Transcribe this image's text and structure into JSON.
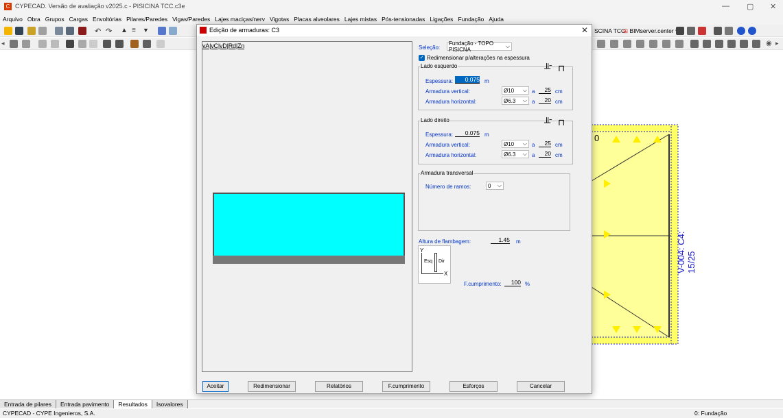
{
  "window": {
    "title": "CYPECAD. Versão de avaliação v2025.c - PISICINA TCC.c3e",
    "minimize": "—",
    "maximize": "▢",
    "close": "✕"
  },
  "menu": [
    "Arquivo",
    "Obra",
    "Grupos",
    "Cargas",
    "Envoltórias",
    "Pilares/Paredes",
    "Vigas/Paredes",
    "Lajes maciças/nerv",
    "Vigotas",
    "Placas alveolares",
    "Lajes mistas",
    "Pós-tensionadas",
    "Ligações",
    "Fundação",
    "Ajuda"
  ],
  "toolbar": {
    "project_label": "SCINA TCC",
    "bim_label": "BIMserver.center"
  },
  "drawing": {
    "beam_label": "V-004: C4: 15/25",
    "small_label": "0"
  },
  "dialog": {
    "title": "Edição de armaduras: C3",
    "close": "✕",
    "preview_tabs": "vA|vC|vD|Rd|Zn",
    "selecao_label": "Seleção:",
    "selecao_value": "Fundação - TOPO PISICNA",
    "redimensionar_label": "Redimensionar p/alterações na espessura",
    "left_side": {
      "title": "Lado esquerdo",
      "espessura_label": "Espessura:",
      "espessura_value": "0.075",
      "espessura_unit": "m",
      "vertical_label": "Armadura vertical:",
      "vertical_diam": "Ø10",
      "vertical_a": "a",
      "vertical_spacing": "25",
      "vertical_unit": "cm",
      "horizontal_label": "Armadura horizontal:",
      "horizontal_diam": "Ø6.3",
      "horizontal_a": "a",
      "horizontal_spacing": "20",
      "horizontal_unit": "cm"
    },
    "right_side": {
      "title": "Lado direito",
      "espessura_label": "Espessura:",
      "espessura_value": "0.075",
      "espessura_unit": "m",
      "vertical_label": "Armadura vertical:",
      "vertical_diam": "Ø10",
      "vertical_a": "a",
      "vertical_spacing": "25",
      "vertical_unit": "cm",
      "horizontal_label": "Armadura horizontal:",
      "horizontal_diam": "Ø6.3",
      "horizontal_a": "a",
      "horizontal_spacing": "20",
      "horizontal_unit": "cm"
    },
    "transversal": {
      "title": "Armadura transversal",
      "ramos_label": "Número de ramos:",
      "ramos_value": "0"
    },
    "flambagem_label": "Altura de flambagem:",
    "flambagem_value": "1.45",
    "flambagem_unit": "m",
    "axis_y": "Y",
    "axis_x": "X",
    "esq": "Esq",
    "dir": "Dir",
    "fcomp_label": "F.cumprimento:",
    "fcomp_value": "100",
    "fcomp_unit": "%",
    "buttons": {
      "aceitar": "Aceitar",
      "redimensionar": "Redimensionar",
      "relatorios": "Relatórios",
      "fcumprimento": "F.cumprimento",
      "esforcos": "Esforços",
      "cancelar": "Cancelar"
    }
  },
  "tabs": [
    "Entrada de pilares",
    "Entrada pavimento",
    "Resultados",
    "Isovalores"
  ],
  "status": {
    "left": "CYPECAD - CYPE Ingenieros, S.A.",
    "right": "0: Fundação"
  },
  "colors": {
    "wall_fill": "#00ffff",
    "slab_fill": "#ffff99",
    "beam_outline": "#1a1acc"
  }
}
